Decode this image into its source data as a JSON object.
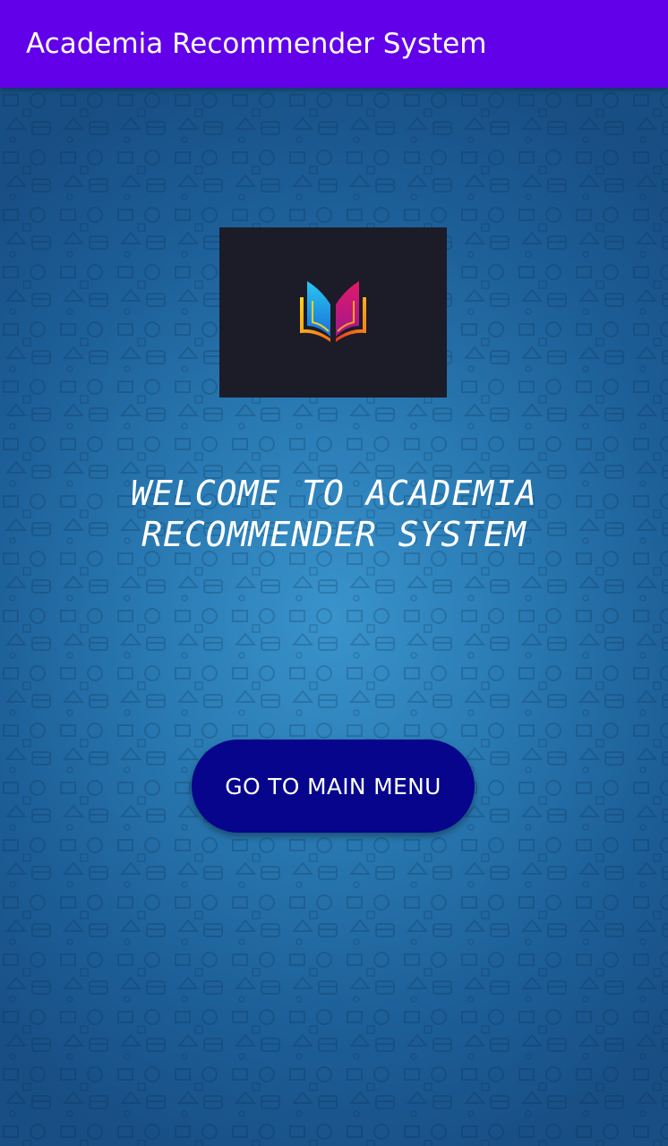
{
  "app_bar": {
    "title": "Academia Recommender System",
    "background_color": "#6200ea"
  },
  "content": {
    "background": "blue patterned gradient",
    "logo": {
      "icon": "open-book-logo-icon",
      "background_color": "#1c1b28"
    },
    "welcome_lines": [
      "WELCOME TO ACADEMIA",
      "RECOMMENDER SYSTEM"
    ],
    "main_menu_button": {
      "label": "GO TO MAIN MENU",
      "background_color": "#06058c"
    }
  }
}
